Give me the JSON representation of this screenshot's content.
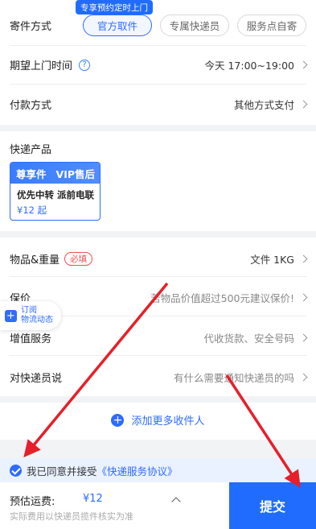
{
  "send_method": {
    "label": "寄件方式",
    "promo_tag": "专享预约定时上门",
    "options": [
      "官方取件",
      "专属快递员",
      "服务点自寄"
    ],
    "selected": "官方取件"
  },
  "pickup_time": {
    "label": "期望上门时间",
    "value": "今天 17:00~19:00"
  },
  "payment": {
    "label": "付款方式",
    "value": "其他方式支付"
  },
  "product": {
    "section_label": "快递产品",
    "brand": "尊享件",
    "tier": "VIP售后",
    "name": "优先中转 派前电联",
    "price": "¥12 起"
  },
  "goods": {
    "label": "物品&重量",
    "required_tag": "必填",
    "value": "文件 1KG"
  },
  "insurance": {
    "label": "保价",
    "value": "若物品价值超过500元建议保价!"
  },
  "value_added": {
    "label": "增值服务",
    "value": "代收货款、安全号码"
  },
  "courier_note": {
    "label": "对快递员说",
    "value": "有什么需要通知快递员的吗"
  },
  "floating_subscribe": {
    "line1": "订阅",
    "line2": "物流动态"
  },
  "add_recipient": {
    "label": "添加更多收件人"
  },
  "agreement": {
    "prefix": "我已同意并接受",
    "link": "《快递服务协议》"
  },
  "footer": {
    "estimate_label": "预估运费:",
    "estimate_value": "¥12",
    "note": "实际费用以快递员揽件核实为准",
    "submit_label": "提交"
  },
  "colors": {
    "accent": "#2f6bff",
    "required": "#f05050",
    "annotation_arrow": "#e5202a"
  }
}
